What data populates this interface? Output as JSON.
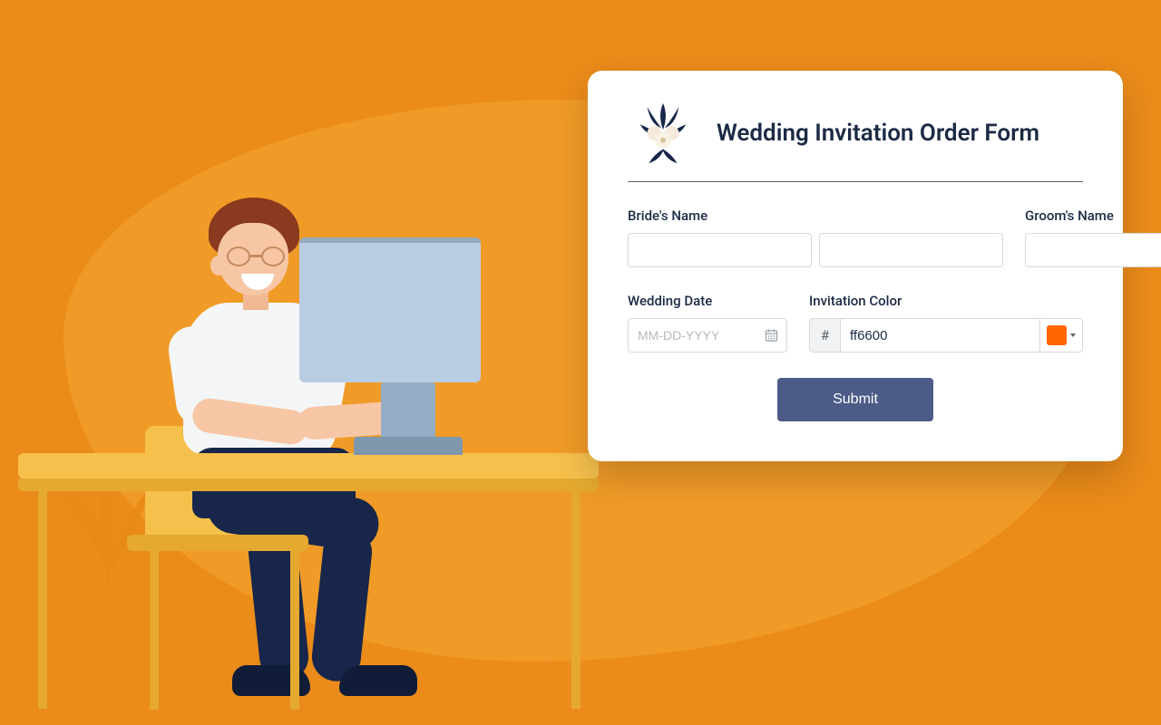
{
  "form": {
    "title": "Wedding Invitation Order Form",
    "fields": {
      "bride_label": "Bride's Name",
      "groom_label": "Groom's Name",
      "date_label": "Wedding Date",
      "date_placeholder": "MM-DD-YYYY",
      "color_label": "Invitation Color",
      "color_prefix": "#",
      "color_value": "ff6600"
    },
    "submit_label": "Submit"
  },
  "colors": {
    "swatch": "#ff6600",
    "submit_bg": "#4c5c87"
  }
}
